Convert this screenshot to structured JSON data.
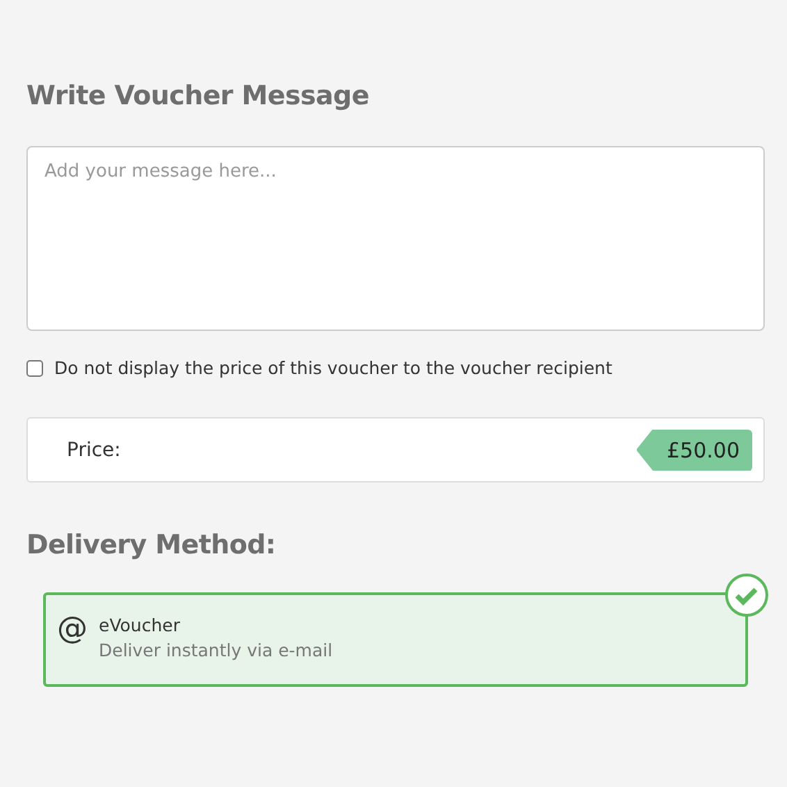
{
  "message_section": {
    "title": "Write Voucher Message",
    "placeholder": "Add your message here..."
  },
  "hide_price": {
    "label": "Do not display the price of this voucher to the voucher recipient",
    "checked": false
  },
  "price": {
    "label": "Price:",
    "value": "£50.00"
  },
  "delivery": {
    "title": "Delivery Method:",
    "options": [
      {
        "icon": "@",
        "name": "eVoucher",
        "description": "Deliver instantly via e-mail",
        "selected": true
      }
    ]
  }
}
